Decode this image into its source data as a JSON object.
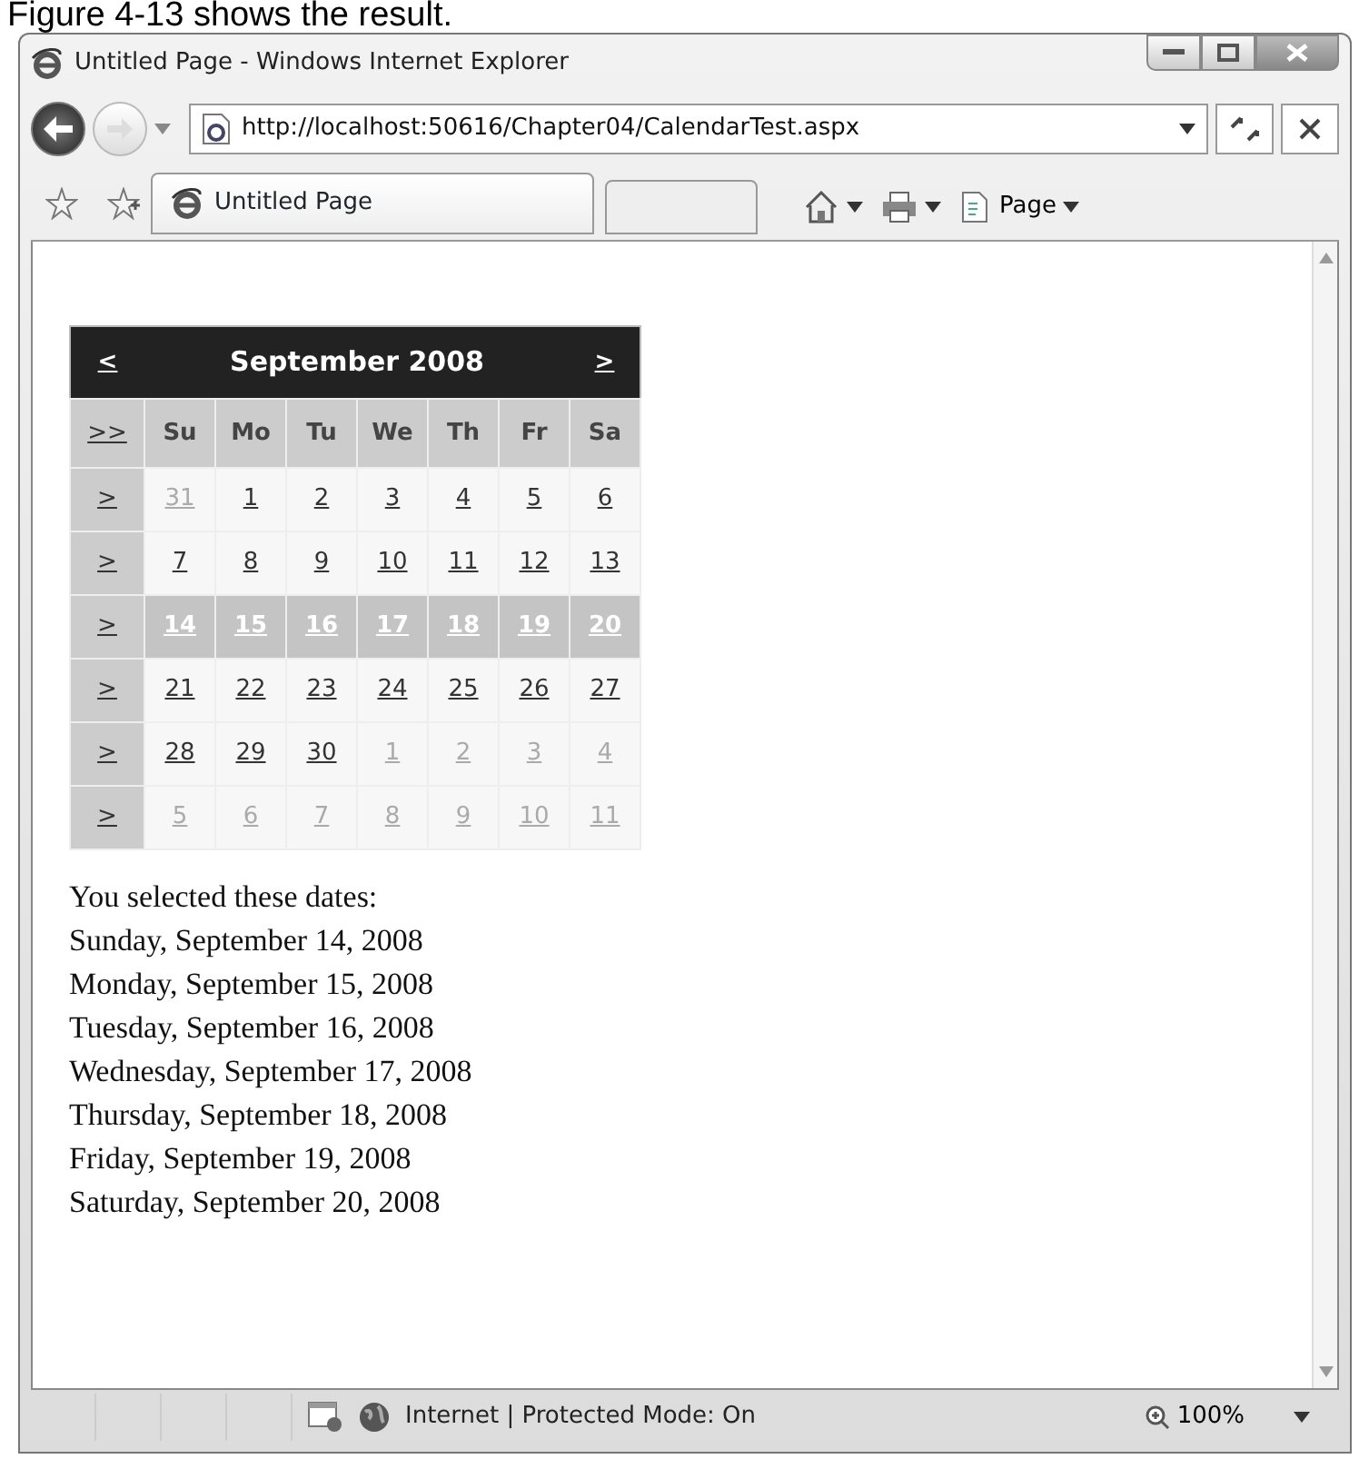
{
  "caption": "Figure 4-13 shows the result.",
  "window": {
    "title": "Untitled Page - Windows Internet Explorer"
  },
  "address_bar": {
    "url": "http://localhost:50616/Chapter04/CalendarTest.aspx"
  },
  "tabs": [
    {
      "label": "Untitled Page",
      "selected": true
    }
  ],
  "toolbar": {
    "page_menu": "Page"
  },
  "calendar": {
    "prev": "<",
    "title": "September 2008",
    "next": ">",
    "select_month": ">>",
    "day_names": [
      "Su",
      "Mo",
      "Tu",
      "We",
      "Th",
      "Fr",
      "Sa"
    ],
    "weeks": [
      {
        "selector": ">",
        "days": [
          {
            "text": "31",
            "other_month": true,
            "selected": false
          },
          {
            "text": "1",
            "other_month": false,
            "selected": false
          },
          {
            "text": "2",
            "other_month": false,
            "selected": false
          },
          {
            "text": "3",
            "other_month": false,
            "selected": false
          },
          {
            "text": "4",
            "other_month": false,
            "selected": false
          },
          {
            "text": "5",
            "other_month": false,
            "selected": false
          },
          {
            "text": "6",
            "other_month": false,
            "selected": false
          }
        ]
      },
      {
        "selector": ">",
        "days": [
          {
            "text": "7",
            "other_month": false,
            "selected": false
          },
          {
            "text": "8",
            "other_month": false,
            "selected": false
          },
          {
            "text": "9",
            "other_month": false,
            "selected": false
          },
          {
            "text": "10",
            "other_month": false,
            "selected": false
          },
          {
            "text": "11",
            "other_month": false,
            "selected": false
          },
          {
            "text": "12",
            "other_month": false,
            "selected": false
          },
          {
            "text": "13",
            "other_month": false,
            "selected": false
          }
        ]
      },
      {
        "selector": ">",
        "days": [
          {
            "text": "14",
            "other_month": false,
            "selected": true
          },
          {
            "text": "15",
            "other_month": false,
            "selected": true
          },
          {
            "text": "16",
            "other_month": false,
            "selected": true
          },
          {
            "text": "17",
            "other_month": false,
            "selected": true
          },
          {
            "text": "18",
            "other_month": false,
            "selected": true
          },
          {
            "text": "19",
            "other_month": false,
            "selected": true
          },
          {
            "text": "20",
            "other_month": false,
            "selected": true
          }
        ]
      },
      {
        "selector": ">",
        "days": [
          {
            "text": "21",
            "other_month": false,
            "selected": false
          },
          {
            "text": "22",
            "other_month": false,
            "selected": false
          },
          {
            "text": "23",
            "other_month": false,
            "selected": false
          },
          {
            "text": "24",
            "other_month": false,
            "selected": false
          },
          {
            "text": "25",
            "other_month": false,
            "selected": false
          },
          {
            "text": "26",
            "other_month": false,
            "selected": false
          },
          {
            "text": "27",
            "other_month": false,
            "selected": false
          }
        ]
      },
      {
        "selector": ">",
        "days": [
          {
            "text": "28",
            "other_month": false,
            "selected": false
          },
          {
            "text": "29",
            "other_month": false,
            "selected": false
          },
          {
            "text": "30",
            "other_month": false,
            "selected": false
          },
          {
            "text": "1",
            "other_month": true,
            "selected": false
          },
          {
            "text": "2",
            "other_month": true,
            "selected": false
          },
          {
            "text": "3",
            "other_month": true,
            "selected": false
          },
          {
            "text": "4",
            "other_month": true,
            "selected": false
          }
        ]
      },
      {
        "selector": ">",
        "days": [
          {
            "text": "5",
            "other_month": true,
            "selected": false
          },
          {
            "text": "6",
            "other_month": true,
            "selected": false
          },
          {
            "text": "7",
            "other_month": true,
            "selected": false
          },
          {
            "text": "8",
            "other_month": true,
            "selected": false
          },
          {
            "text": "9",
            "other_month": true,
            "selected": false
          },
          {
            "text": "10",
            "other_month": true,
            "selected": false
          },
          {
            "text": "11",
            "other_month": true,
            "selected": false
          }
        ]
      }
    ]
  },
  "result": {
    "heading": "You selected these dates:",
    "dates": [
      "Sunday, September 14, 2008",
      "Monday, September 15, 2008",
      "Tuesday, September 16, 2008",
      "Wednesday, September 17, 2008",
      "Thursday, September 18, 2008",
      "Friday, September 19, 2008",
      "Saturday, September 20, 2008"
    ]
  },
  "status_bar": {
    "zone": "Internet | Protected Mode: On",
    "zoom": "100%"
  }
}
